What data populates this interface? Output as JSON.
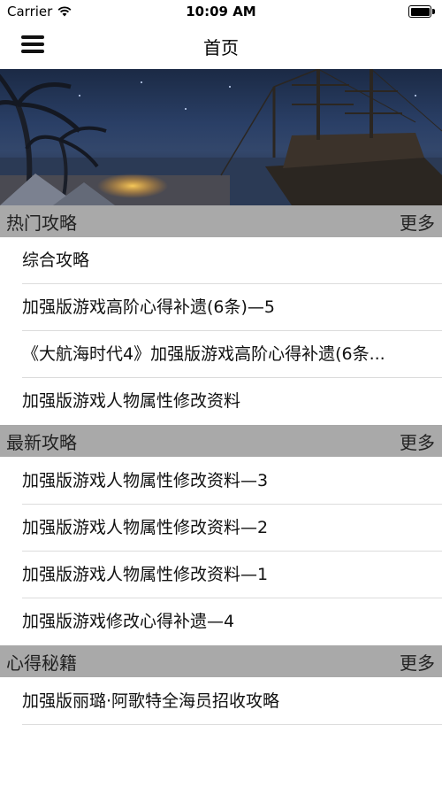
{
  "status_bar": {
    "carrier": "Carrier",
    "time": "10:09 AM"
  },
  "nav": {
    "title": "首页",
    "menu_icon": "hamburger-icon"
  },
  "banner": {
    "pages": 3,
    "active_page": 1
  },
  "sections": [
    {
      "title": "热门攻略",
      "more": "更多",
      "items": [
        "综合攻略",
        "加强版游戏高阶心得补遗(6条)—5",
        "《大航海时代4》加强版游戏高阶心得补遗(6条...",
        "加强版游戏人物属性修改资料"
      ]
    },
    {
      "title": "最新攻略",
      "more": "更多",
      "items": [
        "加强版游戏人物属性修改资料—3",
        "加强版游戏人物属性修改资料—2",
        "加强版游戏人物属性修改资料—1",
        "加强版游戏修改心得补遗—4"
      ]
    },
    {
      "title": "心得秘籍",
      "more": "更多",
      "items": [
        "加强版丽璐·阿歌特全海员招收攻略"
      ]
    }
  ]
}
